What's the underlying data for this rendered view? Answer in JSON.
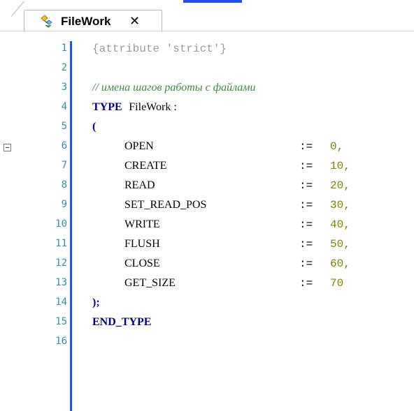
{
  "tab": {
    "title": "FileWork",
    "close_glyph": "✕",
    "icon": "data-type-icon"
  },
  "editor": {
    "line_numbers": [
      "1",
      "2",
      "3",
      "4",
      "5",
      "6",
      "7",
      "8",
      "9",
      "10",
      "11",
      "12",
      "13",
      "14",
      "15",
      "16"
    ],
    "lines": {
      "l1": "{attribute 'strict'}",
      "l3": "// имена шагов работы с файлами",
      "l4_kw": "TYPE",
      "l4_name": "FileWork :",
      "l5": "(",
      "members": [
        {
          "name": "OPEN",
          "op": ":=",
          "value": "0,"
        },
        {
          "name": "CREATE",
          "op": ":=",
          "value": "10,"
        },
        {
          "name": "READ",
          "op": ":=",
          "value": "20,"
        },
        {
          "name": "SET_READ_POS",
          "op": ":=",
          "value": "30,"
        },
        {
          "name": "WRITE",
          "op": ":=",
          "value": "40,"
        },
        {
          "name": "FLUSH",
          "op": ":=",
          "value": "50,"
        },
        {
          "name": "CLOSE",
          "op": ":=",
          "value": "60,"
        },
        {
          "name": "GET_SIZE",
          "op": ":=",
          "value": "70"
        }
      ],
      "l14": ");",
      "l15": "END_TYPE"
    }
  },
  "colors": {
    "gutter_bar": "#2659cf",
    "line_number": "#2b91af",
    "keyword": "#00008b",
    "comment": "#3a8a3a",
    "attribute": "#9a9a9a",
    "number": "#808000"
  }
}
